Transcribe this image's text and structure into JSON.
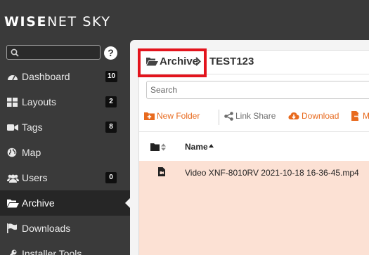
{
  "brand": {
    "wise": "WISE",
    "net": "NET",
    "sky": "SKY"
  },
  "sidebar": {
    "search_placeholder": "",
    "help_label": "?",
    "items": [
      {
        "label": "Dashboard",
        "icon": "dashboard-icon",
        "badge": "10"
      },
      {
        "label": "Layouts",
        "icon": "layouts-icon",
        "badge": "2"
      },
      {
        "label": "Tags",
        "icon": "tags-icon",
        "badge": "8"
      },
      {
        "label": "Map",
        "icon": "globe-icon",
        "badge": null
      },
      {
        "label": "Users",
        "icon": "users-icon",
        "badge": "0"
      },
      {
        "label": "Archive",
        "icon": "folder-open-icon",
        "badge": null,
        "active": true
      },
      {
        "label": "Downloads",
        "icon": "flag-icon",
        "badge": null
      },
      {
        "label": "Installer Tools",
        "icon": "tools-icon",
        "badge": null
      }
    ]
  },
  "breadcrumb": {
    "root": "Archive",
    "current": "TEST123"
  },
  "file_search": {
    "placeholder": "Search"
  },
  "toolbar": {
    "new_folder": "New Folder",
    "link_share": "Link Share",
    "download": "Download",
    "more": "M"
  },
  "table": {
    "name_header": "Name",
    "rows": [
      {
        "name": "Video XNF-8010RV 2021-10-18 16-36-45.mp4",
        "icon": "video-file-icon"
      }
    ]
  },
  "colors": {
    "accent_orange": "#e86a1e",
    "highlight_red": "#e3141d",
    "selected_row": "#fce1d4",
    "sidebar_bg": "#3a3a3a"
  }
}
